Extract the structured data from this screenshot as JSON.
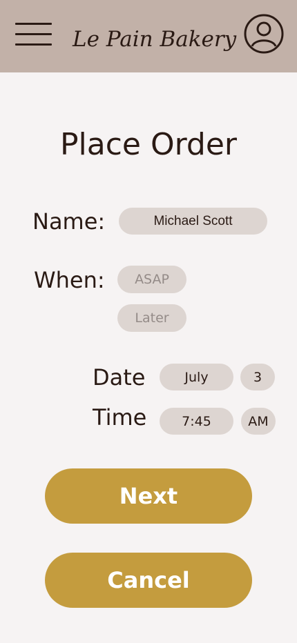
{
  "header": {
    "brand": "Le Pain Bakery",
    "menu_icon": "hamburger-menu-icon",
    "profile_icon": "user-avatar-icon",
    "background_color": "#c2b1a8"
  },
  "page": {
    "title": "Place Order"
  },
  "form": {
    "name_label": "Name:",
    "name_value": "Michael Scott",
    "when_label": "When:",
    "when_options": [
      "ASAP",
      "Later"
    ],
    "date_label": "Date",
    "date_month": "July",
    "date_day": "3",
    "time_label": "Time",
    "time_value": "7:45",
    "time_period": "AM"
  },
  "actions": {
    "next_label": "Next",
    "cancel_label": "Cancel",
    "button_color": "#c49c3e"
  }
}
